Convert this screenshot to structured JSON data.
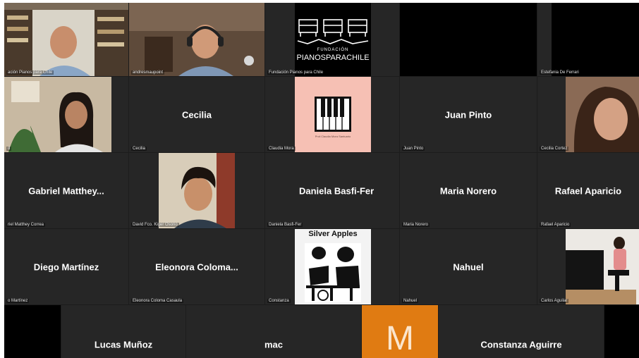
{
  "meeting": {
    "participants": [
      {
        "id": "p01",
        "label": "ación Pianos para Chile",
        "display": "",
        "kind": "video"
      },
      {
        "id": "p02",
        "label": "andresmaupoint",
        "display": "",
        "kind": "video"
      },
      {
        "id": "p03",
        "label": "Fundación Pianos para Chile",
        "display": "",
        "kind": "logo",
        "logo_line1": "FUNDACIÓN",
        "logo_line2": "PIANOSPARACHILE"
      },
      {
        "id": "p04",
        "label": "",
        "display": "",
        "kind": "black"
      },
      {
        "id": "p05",
        "label": "Estefania De Ferrari",
        "display": "",
        "kind": "black"
      },
      {
        "id": "p06",
        "label": "d",
        "display": "",
        "kind": "video"
      },
      {
        "id": "p07",
        "label": "Cecilia",
        "display": "Cecilia",
        "kind": "name"
      },
      {
        "id": "p08",
        "label": "Claudia Mora",
        "display": "",
        "kind": "piano",
        "caption": "Prof.Claudia Mora Santuario"
      },
      {
        "id": "p09",
        "label": "Juan Pinto",
        "display": "Juan Pinto",
        "kind": "name"
      },
      {
        "id": "p10",
        "label": "Cecilia Cortez",
        "display": "",
        "kind": "video"
      },
      {
        "id": "p11",
        "label": "riel Matthey Correa",
        "display": "Gabriel  Matthey...",
        "kind": "name"
      },
      {
        "id": "p12",
        "label": "David Fco. Kiger Osorio",
        "display": "",
        "kind": "video"
      },
      {
        "id": "p13",
        "label": "Daniela Basfi-Fer",
        "display": "Daniela Basfi-Fer",
        "kind": "name"
      },
      {
        "id": "p14",
        "label": "Maria Norero",
        "display": "Maria Norero",
        "kind": "name"
      },
      {
        "id": "p15",
        "label": "Rafael Aparicio",
        "display": "Rafael Aparicio",
        "kind": "name"
      },
      {
        "id": "p16",
        "label": "o Martínez",
        "display": "Diego Martínez",
        "kind": "name"
      },
      {
        "id": "p17",
        "label": "Eleonora Coloma Casaula",
        "display": "Eleonora  Coloma...",
        "kind": "name"
      },
      {
        "id": "p18",
        "label": "Constanza",
        "display": "",
        "kind": "album",
        "album_title": "Silver Apples"
      },
      {
        "id": "p19",
        "label": "Nahuel",
        "display": "Nahuel",
        "kind": "name"
      },
      {
        "id": "p20",
        "label": "Carlos Aguilar",
        "display": "",
        "kind": "video"
      },
      {
        "id": "p21",
        "label": "",
        "display": "Lucas Muñoz",
        "kind": "name"
      },
      {
        "id": "p22",
        "label": "",
        "display": "mac",
        "kind": "name"
      },
      {
        "id": "p23",
        "label": "",
        "display": "",
        "kind": "avatar",
        "initial": "M"
      },
      {
        "id": "p24",
        "label": "",
        "display": "Constanza Aguirre",
        "kind": "name"
      }
    ]
  },
  "colors": {
    "avatar_orange": "#e07b12",
    "piano_pink": "#f6c0b4",
    "tile_bg": "#262626",
    "stage_bg": "#1c1c1c"
  }
}
